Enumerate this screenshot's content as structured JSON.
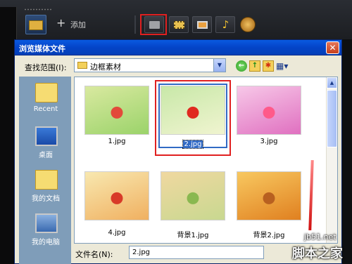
{
  "toolbar": {
    "add_label": "添加",
    "buttons": [
      "folder-icon",
      "filmstrip-icon",
      "image-icon",
      "music-note-icon",
      "settings-dial-icon"
    ]
  },
  "dialog": {
    "title": "浏览媒体文件",
    "close_glyph": "✕",
    "look_in_label": "查找范围(I):",
    "look_in_value": "边框素材",
    "places": [
      {
        "label": "Recent",
        "icon": "recent-folder-icon"
      },
      {
        "label": "桌面",
        "icon": "desktop-icon"
      },
      {
        "label": "我的文档",
        "icon": "my-documents-icon"
      },
      {
        "label": "我的电脑",
        "icon": "my-computer-icon"
      }
    ],
    "files": [
      {
        "name": "1.jpg",
        "colors": [
          "#d9e9a0",
          "#9bd36a",
          "#e24a3a"
        ]
      },
      {
        "name": "2.jpg",
        "colors": [
          "#c8e8a8",
          "#f0f4d0",
          "#e02a20"
        ],
        "selected": true
      },
      {
        "name": "3.jpg",
        "colors": [
          "#f7c8e8",
          "#e070c0",
          "#ff5a8a"
        ]
      },
      {
        "name": "4.jpg",
        "colors": [
          "#f8e8b0",
          "#f0b060",
          "#d83a28"
        ]
      },
      {
        "name": "背景1.jpg",
        "colors": [
          "#f0d8a0",
          "#c8d890",
          "#8ab850"
        ]
      },
      {
        "name": "背景2.jpg",
        "colors": [
          "#f8c860",
          "#e08020",
          "#b86020"
        ]
      }
    ],
    "file_name_label": "文件名(N):",
    "file_name_value": "2.jpg"
  },
  "watermark": {
    "line1": "jb51.net",
    "line2": "脚本之家"
  },
  "colors": {
    "highlight_red": "#e02020",
    "selection_blue": "#316ac5",
    "titlebar_blue": "#0a5ae0"
  }
}
